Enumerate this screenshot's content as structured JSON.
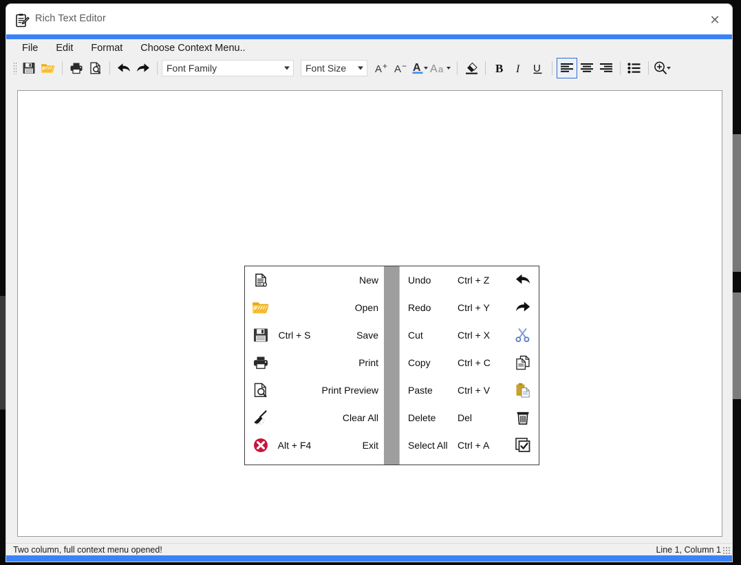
{
  "window": {
    "title": "Rich Text Editor",
    "title_icon": "clipboard-pencil-icon",
    "close_label": "✕",
    "accent_color": "#3b82f6"
  },
  "menubar": {
    "items": [
      {
        "label": "File"
      },
      {
        "label": "Edit"
      },
      {
        "label": "Format"
      },
      {
        "label": "Choose Context Menu.."
      }
    ]
  },
  "toolbar": {
    "font_family": {
      "value": "Font Family",
      "icon": "chevron-down-icon"
    },
    "font_size": {
      "value": "Font Size",
      "icon": "chevron-down-icon"
    },
    "buttons": [
      {
        "name": "save-button",
        "icon": "floppy-disk-icon"
      },
      {
        "name": "open-button",
        "icon": "open-folder-icon"
      },
      {
        "name": "print-button",
        "icon": "printer-icon"
      },
      {
        "name": "print-preview-button",
        "icon": "print-preview-icon"
      },
      {
        "name": "undo-button",
        "icon": "undo-arrow-icon"
      },
      {
        "name": "redo-button",
        "icon": "redo-arrow-icon"
      },
      {
        "name": "increase-font-size-button",
        "icon": "a-plus-icon"
      },
      {
        "name": "decrease-font-size-button",
        "icon": "a-minus-icon"
      },
      {
        "name": "font-color-button",
        "icon": "font-color-a-icon"
      },
      {
        "name": "change-case-button",
        "icon": "change-case-aa-icon"
      },
      {
        "name": "clear-formatting-button",
        "icon": "eraser-icon"
      },
      {
        "name": "bold-button",
        "icon": "bold-b-icon"
      },
      {
        "name": "italic-button",
        "icon": "italic-i-icon"
      },
      {
        "name": "underline-button",
        "icon": "underline-u-icon"
      },
      {
        "name": "align-left-button",
        "icon": "align-left-icon"
      },
      {
        "name": "align-center-button",
        "icon": "align-center-icon"
      },
      {
        "name": "align-right-button",
        "icon": "align-right-icon"
      },
      {
        "name": "bullet-list-button",
        "icon": "bullet-list-icon"
      },
      {
        "name": "zoom-button",
        "icon": "zoom-in-magnifier-icon"
      }
    ],
    "selected_button": "align-left-button",
    "selection_border_color": "#2f6fd0"
  },
  "editor": {
    "content": ""
  },
  "context_menu": {
    "gutter_color": "#9e9e9e",
    "left_column": [
      {
        "icon": "new-document-icon",
        "shortcut": "",
        "label": "New"
      },
      {
        "icon": "open-folder-icon",
        "shortcut": "",
        "label": "Open"
      },
      {
        "icon": "floppy-disk-icon",
        "shortcut": "Ctrl + S",
        "label": "Save"
      },
      {
        "icon": "printer-icon",
        "shortcut": "",
        "label": "Print"
      },
      {
        "icon": "print-preview-icon",
        "shortcut": "",
        "label": "Print Preview"
      },
      {
        "icon": "broom-clear-icon",
        "shortcut": "",
        "label": "Clear All"
      },
      {
        "icon": "red-x-circle-icon",
        "shortcut": "Alt + F4",
        "label": "Exit"
      }
    ],
    "right_column": [
      {
        "label": "Undo",
        "shortcut": "Ctrl + Z",
        "icon": "undo-arrow-icon"
      },
      {
        "label": "Redo",
        "shortcut": "Ctrl + Y",
        "icon": "redo-arrow-icon"
      },
      {
        "label": "Cut",
        "shortcut": "Ctrl + X",
        "icon": "scissors-icon"
      },
      {
        "label": "Copy",
        "shortcut": "Ctrl + C",
        "icon": "copy-pages-icon"
      },
      {
        "label": "Paste",
        "shortcut": "Ctrl + V",
        "icon": "clipboard-paste-icon"
      },
      {
        "label": "Delete",
        "shortcut": "Del",
        "icon": "trash-can-icon"
      },
      {
        "label": "Select All",
        "shortcut": "Ctrl + A",
        "icon": "select-all-checkbox-icon"
      }
    ]
  },
  "statusbar": {
    "message": "Two column, full context menu opened!",
    "caret_position": "Line 1, Column 1"
  }
}
